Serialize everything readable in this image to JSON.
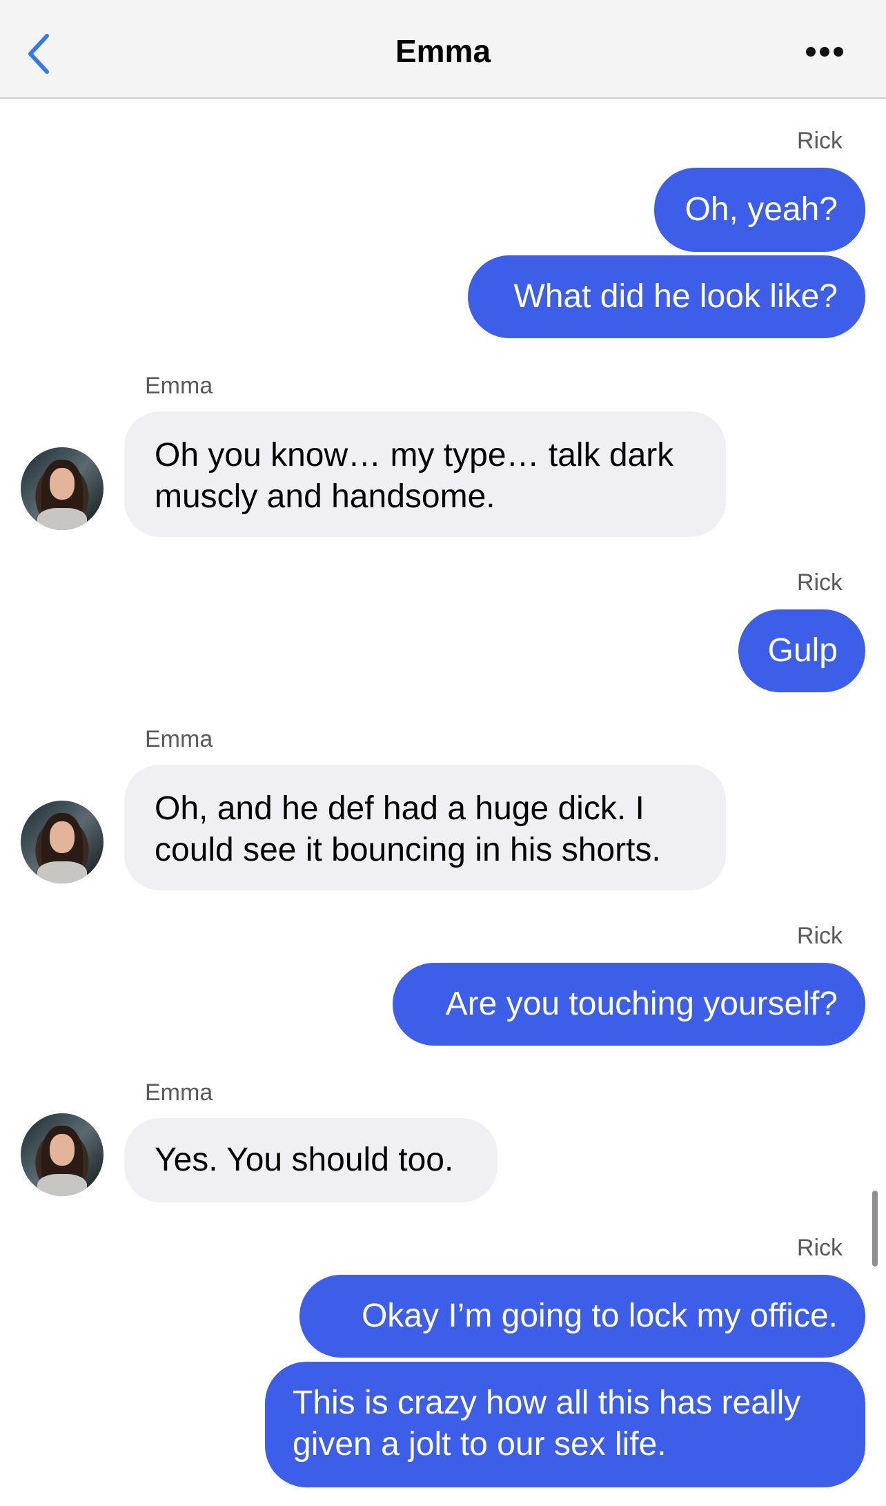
{
  "header": {
    "title": "Emma",
    "back_icon": "chevron-left-icon",
    "more_icon": "ellipsis-icon",
    "accent_color": "#3478f6"
  },
  "colors": {
    "outgoing_bubble": "#3d5ee8",
    "incoming_bubble": "#f0f0f4"
  },
  "messages": [
    {
      "sender": "Rick",
      "text": "Oh, yeah?"
    },
    {
      "sender": "Rick",
      "text": "What did he look like?"
    },
    {
      "sender": "Emma",
      "text": "Oh you know… my type… talk dark muscly and handsome."
    },
    {
      "sender": "Rick",
      "text": "Gulp"
    },
    {
      "sender": "Emma",
      "text": "Oh, and he def had a huge dick. I could see it bouncing in his shorts."
    },
    {
      "sender": "Rick",
      "text": "Are you touching yourself?"
    },
    {
      "sender": "Emma",
      "text": "Yes. You should too."
    },
    {
      "sender": "Rick",
      "text": "Okay I’m going to lock my office."
    },
    {
      "sender": "Rick",
      "text": "This is crazy how all this has really given a jolt to our sex life."
    }
  ]
}
